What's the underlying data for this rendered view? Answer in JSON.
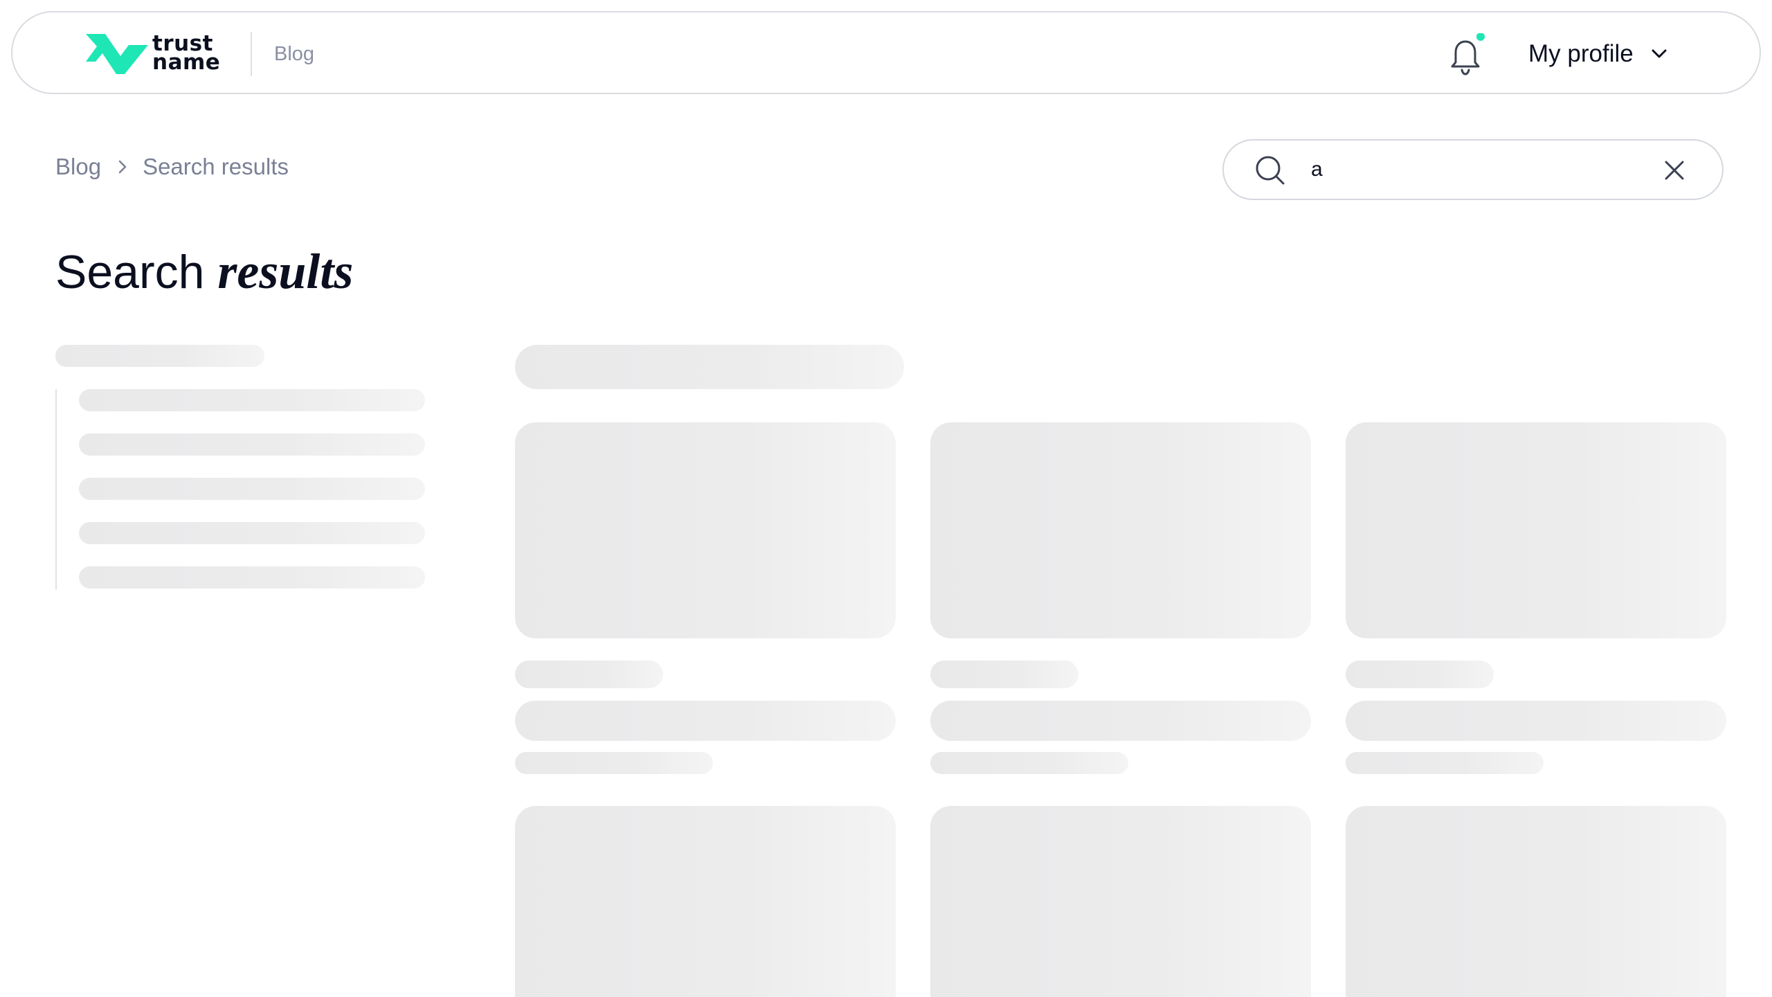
{
  "brand": {
    "name_line1": "trust",
    "name_line2": "name",
    "accent_color": "#1ee6b5"
  },
  "header": {
    "section_label": "Blog",
    "notification_icon": "bell-icon",
    "notification_dot_color": "#1ee6b5",
    "profile_label": "My profile",
    "profile_icon": "chevron-down-icon"
  },
  "breadcrumb": {
    "items": [
      "Blog",
      "Search results"
    ],
    "separator_icon": "chevron-right-icon"
  },
  "search": {
    "value": "a",
    "icon": "search-icon",
    "clear_icon": "close-icon"
  },
  "page": {
    "title_plain": "Search ",
    "title_italic": "results"
  },
  "state": {
    "loading": true,
    "skeleton_sidebar_items": 5,
    "skeleton_cards_visible": 6
  }
}
